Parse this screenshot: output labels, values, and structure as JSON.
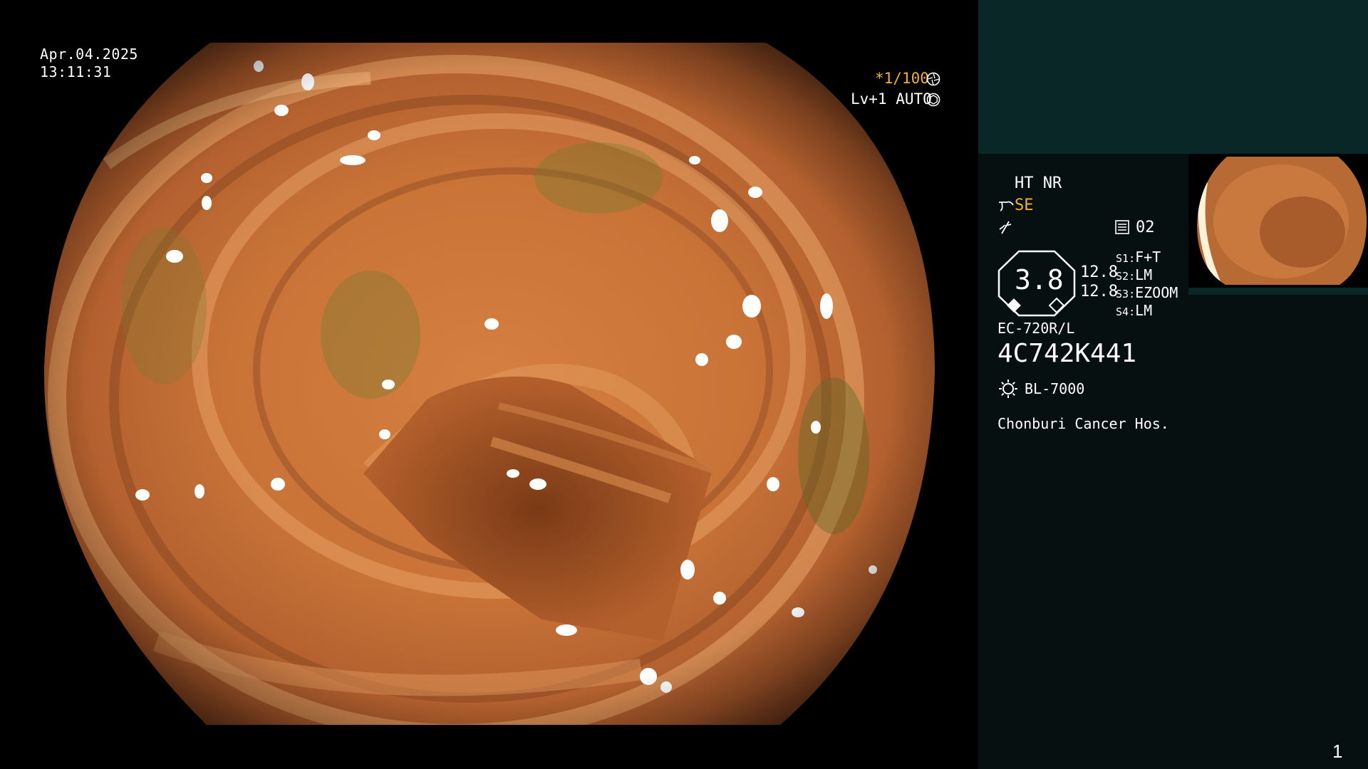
{
  "capture": {
    "date": "Apr.04.2025",
    "time": "13:11:31"
  },
  "overlay": {
    "shutter": "*1/100",
    "shutter_icon": "aperture-icon",
    "level": "Lv+1 AUTO",
    "level_icon": "iris-icon"
  },
  "settings": {
    "ht_nr": "HT NR",
    "se": "SE",
    "se_icon": "tilde-hook-icon",
    "f_icon": "lightning-icon",
    "memory_icon": "memory-icon",
    "memory_value": "02",
    "gauge_value": "3.8",
    "gauge_icon": "octagon-gauge-icon",
    "val_top": "12.8",
    "val_bottom": "12.8",
    "switches": [
      {
        "key": "S1",
        "value": "F+T"
      },
      {
        "key": "S2",
        "value": "LM"
      },
      {
        "key": "S3",
        "value": "EZOOM"
      },
      {
        "key": "S4",
        "value": "LM"
      }
    ]
  },
  "scope": {
    "model": "EC-720R/L",
    "serial": "4C742K441"
  },
  "light": {
    "icon": "light-source-icon",
    "name": "BL-7000"
  },
  "hospital": "Chonburi Cancer Hos.",
  "page_number": "1",
  "colors": {
    "accent_orange": "#f3b032",
    "sidebar_top": "#0a2727",
    "sidebar": "#061010",
    "tissue": "#c8733a"
  }
}
